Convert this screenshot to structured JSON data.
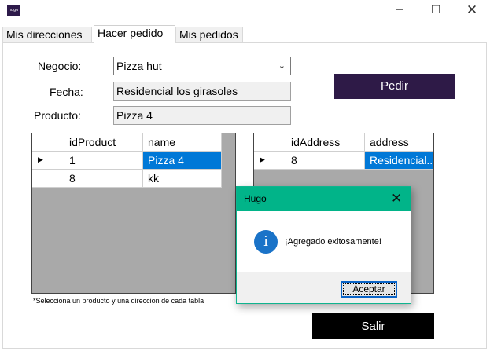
{
  "window": {
    "app_icon_text": "hugo",
    "minimize": "─",
    "maximize": "☐",
    "close": "✕"
  },
  "tabs": [
    {
      "label": "Mis direcciones",
      "active": false
    },
    {
      "label": "Hacer pedido",
      "active": true
    },
    {
      "label": "Mis pedidos",
      "active": false
    }
  ],
  "form": {
    "negocio_label": "Negocio:",
    "negocio_value": "Pizza hut",
    "fecha_label": "Fecha:",
    "fecha_value": "Residencial los girasoles",
    "producto_label": "Producto:",
    "producto_value": "Pizza 4",
    "pedir_button": "Pedir",
    "salir_button": "Salir",
    "hint": "*Selecciona un producto y una direccion de cada tabla"
  },
  "products_grid": {
    "columns": [
      "idProduct",
      "name"
    ],
    "rows": [
      {
        "id": "1",
        "name": "Pizza 4",
        "current": true
      },
      {
        "id": "8",
        "name": "kk",
        "current": false
      }
    ]
  },
  "address_grid": {
    "columns": [
      "idAddress",
      "address"
    ],
    "rows": [
      {
        "id": "8",
        "address": "Residencial...",
        "current": true
      }
    ]
  },
  "dialog": {
    "title": "Hugo",
    "close": "✕",
    "icon": "i",
    "message": "¡Agregado exitosamente!",
    "ok_button": "Aceptar"
  },
  "colors": {
    "accent_purple": "#2e1a47",
    "dialog_title": "#01b489",
    "selection": "#0078d7",
    "info_icon": "#1a73c8"
  }
}
